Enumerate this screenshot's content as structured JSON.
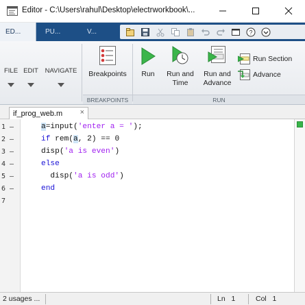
{
  "window": {
    "title": "Editor - C:\\Users\\rahul\\Desktop\\electrworkbook\\...",
    "controls": [
      "minimize",
      "maximize",
      "close"
    ]
  },
  "ribbon": {
    "tabs": [
      {
        "label": "ED..."
      },
      {
        "label": "PU..."
      },
      {
        "label": "V..."
      }
    ],
    "quick_access_icons": [
      "open-icon",
      "save-icon",
      "cut-icon",
      "copy-icon",
      "paste-icon",
      "undo-icon",
      "redo-icon",
      "window-icon",
      "help-icon",
      "dropdown-icon"
    ]
  },
  "toolstrip": {
    "file_label": "FILE",
    "edit_label": "EDIT",
    "navigate_label": "NAVIGATE",
    "breakpoints_label": "Breakpoints",
    "breakpoints_group": "BREAKPOINTS",
    "run_label": "Run",
    "run_and_time_line1": "Run and",
    "run_and_time_line2": "Time",
    "run_and_advance_line1": "Run and",
    "run_and_advance_line2": "Advance",
    "run_section_label": "Run Section",
    "advance_label": "Advance",
    "run_group": "RUN"
  },
  "file_tab": {
    "name": "if_prog_web.m",
    "close": "×"
  },
  "editor": {
    "line_numbers": [
      "1 –",
      "2 –",
      "3 –",
      "4 –",
      "5 –",
      "6 –",
      "7"
    ]
  },
  "statusbar": {
    "usages": "2 usages ...",
    "ln_label": "Ln",
    "ln_value": "1",
    "col_label": "Col",
    "col_value": "1"
  },
  "colors": {
    "ribbon_blue": "#1d4f86",
    "keyword": "#1a12d6",
    "string": "#a020f0",
    "ok_indicator": "#38b54a"
  }
}
